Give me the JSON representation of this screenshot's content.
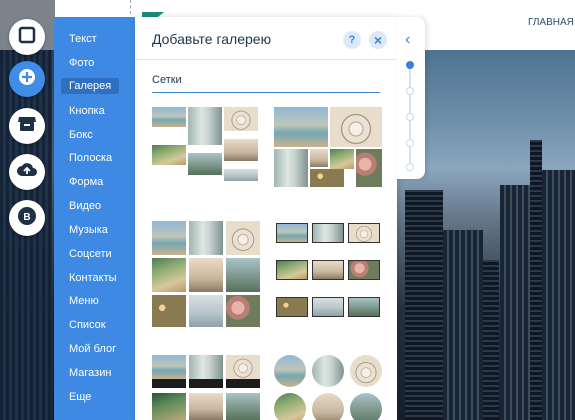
{
  "site_preview": {
    "nav_item": "ГЛАВНАЯ"
  },
  "left_rail": {
    "buttons": [
      {
        "icon": "layout-square-icon"
      },
      {
        "icon": "plus-icon"
      },
      {
        "icon": "store-icon"
      },
      {
        "icon": "cloud-upload-icon"
      },
      {
        "icon": "blog-b-icon",
        "label": "B"
      }
    ]
  },
  "categories": {
    "selected": "Галерея",
    "items": [
      "Текст",
      "Фото",
      "Галерея",
      "Кнопка",
      "Бокс",
      "Полоска",
      "Форма",
      "Видео",
      "Музыка",
      "Соцсети",
      "Контакты",
      "Меню",
      "Список",
      "Мой блог",
      "Магазин",
      "Еще"
    ]
  },
  "panel": {
    "title": "Добавьте галерею",
    "help_label": "?",
    "close_label": "×",
    "section_title": "Сетки"
  },
  "collapse": {
    "arrow": "‹"
  },
  "accent_colors": {
    "blue": "#3d89e3",
    "dark_blue": "#2f6fbf"
  }
}
